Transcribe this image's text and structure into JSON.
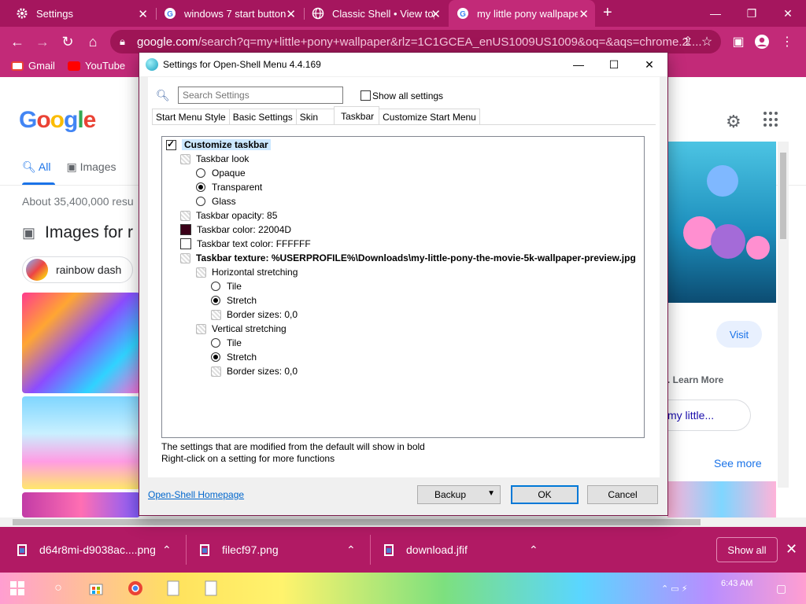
{
  "browser": {
    "tabs": [
      {
        "title": "Settings",
        "favicon": "gear-icon"
      },
      {
        "title": "windows 7 start button",
        "favicon": "google-icon"
      },
      {
        "title": "Classic Shell • View top",
        "favicon": "globe-icon"
      },
      {
        "title": "my little pony wallpape",
        "favicon": "google-icon",
        "active": true
      }
    ],
    "url_host": "google.com",
    "url_path": "/search?q=my+little+pony+wallpaper&rlz=1C1GCEA_enUS1009US1009&oq=&aqs=chrome.2....",
    "bookmarks": [
      {
        "label": "Gmail",
        "icon": "gmail-icon"
      },
      {
        "label": "YouTube",
        "icon": "youtube-icon"
      }
    ],
    "accent": "#c22a78"
  },
  "google": {
    "logo": [
      "G",
      "o",
      "o",
      "g",
      "l",
      "e"
    ],
    "logo_colors": [
      "#4285f4",
      "#ea4335",
      "#fbbc05",
      "#4285f4",
      "#34a853",
      "#ea4335"
    ],
    "tab_all": "All",
    "tab_images": "Images",
    "result_stats": "About 35,400,000 resu",
    "images_header": "Images for r",
    "chip": "rainbow dash",
    "visit": "Visit",
    "learn_more": ". Learn More",
    "my_little": "my little...",
    "see_more": "See more"
  },
  "downloads": {
    "items": [
      "d64r8mi-d9038ac....png",
      "filecf97.png",
      "download.jfif"
    ],
    "show_all": "Show all"
  },
  "taskbar": {
    "time": "6:43 AM"
  },
  "dialog": {
    "title": "Settings for Open-Shell Menu 4.4.169",
    "search_placeholder": "Search Settings",
    "show_all_settings": "Show all settings",
    "tabs": [
      "Start Menu Style",
      "Basic Settings",
      "Skin",
      "Taskbar",
      "Customize Start Menu"
    ],
    "selected_tab": "Taskbar",
    "tree": [
      {
        "label": "Customize taskbar",
        "kind": "checkbox",
        "checked": true,
        "bold": true
      },
      {
        "label": "Taskbar look",
        "kind": "gear"
      },
      {
        "label": "Opaque",
        "kind": "radio",
        "on": false
      },
      {
        "label": "Transparent",
        "kind": "radio",
        "on": true
      },
      {
        "label": "Glass",
        "kind": "radio",
        "on": false
      },
      {
        "label": "Taskbar opacity: 85",
        "kind": "gear"
      },
      {
        "label": "Taskbar color: 22004D",
        "kind": "swatch",
        "color": "#3a0018"
      },
      {
        "label": "Taskbar text color: FFFFFF",
        "kind": "swatch",
        "color": "#ffffff"
      },
      {
        "label": "Taskbar texture: %USERPROFILE%\\Downloads\\my-little-pony-the-movie-5k-wallpaper-preview.jpg",
        "kind": "gear",
        "bold": true
      },
      {
        "label": "Horizontal stretching",
        "kind": "gear"
      },
      {
        "label": "Tile",
        "kind": "radio",
        "on": false
      },
      {
        "label": "Stretch",
        "kind": "radio",
        "on": true
      },
      {
        "label": "Border sizes: 0,0",
        "kind": "gear"
      },
      {
        "label": "Vertical stretching",
        "kind": "gear"
      },
      {
        "label": "Tile",
        "kind": "radio",
        "on": false
      },
      {
        "label": "Stretch",
        "kind": "radio",
        "on": true
      },
      {
        "label": "Border sizes: 0,0",
        "kind": "gear"
      }
    ],
    "note1": "The settings that are modified from the default will show in bold",
    "note2": "Right-click on a setting for more functions",
    "homepage": "Open-Shell Homepage",
    "backup": "Backup",
    "ok": "OK",
    "cancel": "Cancel"
  }
}
